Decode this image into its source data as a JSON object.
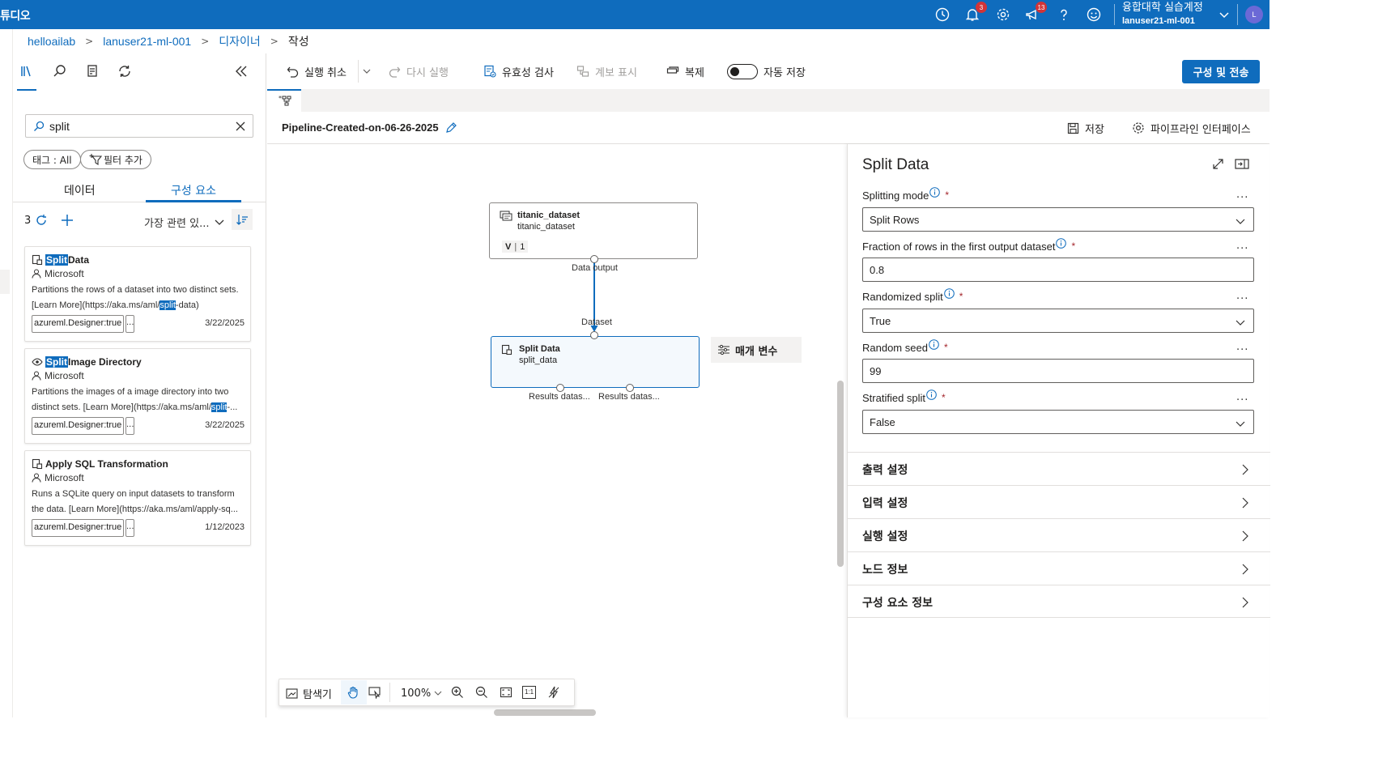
{
  "topbar": {
    "app_name": "튜디오",
    "notifications_count": "3",
    "feedback_count": "13",
    "org_name": "융합대학 실습계정",
    "workspace": "lanuser21-ml-001",
    "avatar_initial": "L"
  },
  "breadcrumb": {
    "items": [
      "helloailab",
      "lanuser21-ml-001",
      "디자이너",
      "작성"
    ]
  },
  "left_panel": {
    "search_value": "split",
    "tag_filter": "태그 : All",
    "add_filter": "필터 추가",
    "tabs": [
      "데이터",
      "구성 요소"
    ],
    "result_count": "3",
    "sort_label": "가장 관련 있...",
    "cards": [
      {
        "title_highlight": "Split",
        "title_rest": " Data",
        "author": "Microsoft",
        "desc_line1": "Partitions the rows of a dataset into two distinct sets.",
        "desc_line2_pre": "[Learn More](https://aka.ms/aml/",
        "desc_line2_hl": "split",
        "desc_line2_post": "-data)",
        "tag": "azureml.Designer:true",
        "more": "...",
        "date": "3/22/2025"
      },
      {
        "title_highlight": "Split",
        "title_rest": " Image Directory",
        "author": "Microsoft",
        "desc_line1": "Partitions the images of a image directory into two",
        "desc_line2_pre": "distinct sets. [Learn More](https://aka.ms/aml/",
        "desc_line2_hl": "split",
        "desc_line2_post": "-...",
        "tag": "azureml.Designer:true",
        "more": "...",
        "date": "3/22/2025"
      },
      {
        "title_highlight": "",
        "title_rest": "Apply SQL Transformation",
        "author": "Microsoft",
        "desc_line1": "Runs a SQLite query on input datasets to transform",
        "desc_line2_pre": "the data. [Learn More](https://aka.ms/aml/apply-sq...",
        "desc_line2_hl": "",
        "desc_line2_post": "",
        "tag": "azureml.Designer:true",
        "more": "...",
        "date": "1/12/2023"
      }
    ]
  },
  "toolbar": {
    "undo": "실행 취소",
    "redo": "다시 실행",
    "validate": "유효성 검사",
    "show_lineage": "계보 표시",
    "clone": "복제",
    "autosave": "자동 저장",
    "autosave_on": false,
    "submit": "구성 및 전송"
  },
  "pipeline": {
    "name": "Pipeline-Created-on-06-26-2025",
    "save": "저장",
    "interface": "파이프라인 인터페이스"
  },
  "canvas": {
    "node1": {
      "title": "titanic_dataset",
      "subtitle": "titanic_dataset",
      "version_label": "V",
      "version_value": "1",
      "output_port": "Data output"
    },
    "node2": {
      "title": "Split Data",
      "subtitle": "split_data",
      "input_port": "Dataset",
      "output_port_1": "Results datas...",
      "output_port_2": "Results datas..."
    },
    "params_chip": "매개 변수",
    "zoom": {
      "explorer": "탐색기",
      "zoom_level": "100%",
      "fit_label": "1:1"
    }
  },
  "right_panel": {
    "title": "Split Data",
    "fields": [
      {
        "label": "Splitting mode",
        "value": "Split Rows",
        "type": "dropdown"
      },
      {
        "label": "Fraction of rows in the first output dataset",
        "value": "0.8",
        "type": "text"
      },
      {
        "label": "Randomized split",
        "value": "True",
        "type": "dropdown"
      },
      {
        "label": "Random seed",
        "value": "99",
        "type": "text"
      },
      {
        "label": "Stratified split",
        "value": "False",
        "type": "dropdown"
      }
    ],
    "required_mark": "*",
    "more": "...",
    "sections": [
      "출력 설정",
      "입력 설정",
      "실행 설정",
      "노드 정보",
      "구성 요소 정보"
    ]
  },
  "colors": {
    "brand": "#0f6cbd",
    "badge": "#d13438",
    "required": "#a4262c"
  }
}
